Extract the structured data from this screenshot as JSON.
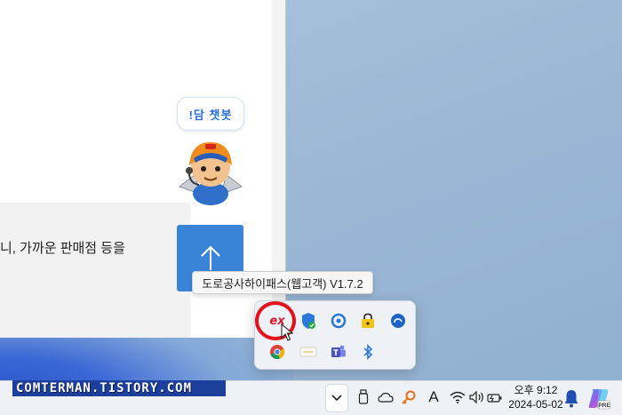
{
  "watermark": {
    "text": "COMTERMAN.TISTORY.COM"
  },
  "browser": {
    "content_text": "니, 가까운 판매점 등을",
    "chatbot_label": "!담 챗봇",
    "scroll_top_icon": "arrow-up-icon"
  },
  "tooltip": {
    "text": "도로공사하이패스(웹고객) V1.7.2"
  },
  "tray_flyout": {
    "icons": [
      {
        "name": "ex-hipass-icon",
        "label": "ex"
      },
      {
        "name": "windows-security-icon"
      },
      {
        "name": "circle-app-icon"
      },
      {
        "name": "lock-app-icon"
      },
      {
        "name": "cloud-app-icon"
      },
      {
        "name": "chrome-icon"
      },
      {
        "name": "blank-app-icon"
      },
      {
        "name": "teams-icon"
      },
      {
        "name": "bluetooth-icon"
      }
    ]
  },
  "taskbar": {
    "overflow_icon": "chevron-down-icon",
    "ime_label": "A",
    "clock": {
      "time": "오후 9:12",
      "date": "2024-05-02"
    },
    "copilot_badge": "PRE"
  },
  "colors": {
    "accent_blue": "#3a84d8",
    "highlight_red": "#e3131b",
    "taskbar_bg": "#eef1f6",
    "watermark_bg": "#1d3f9c"
  }
}
